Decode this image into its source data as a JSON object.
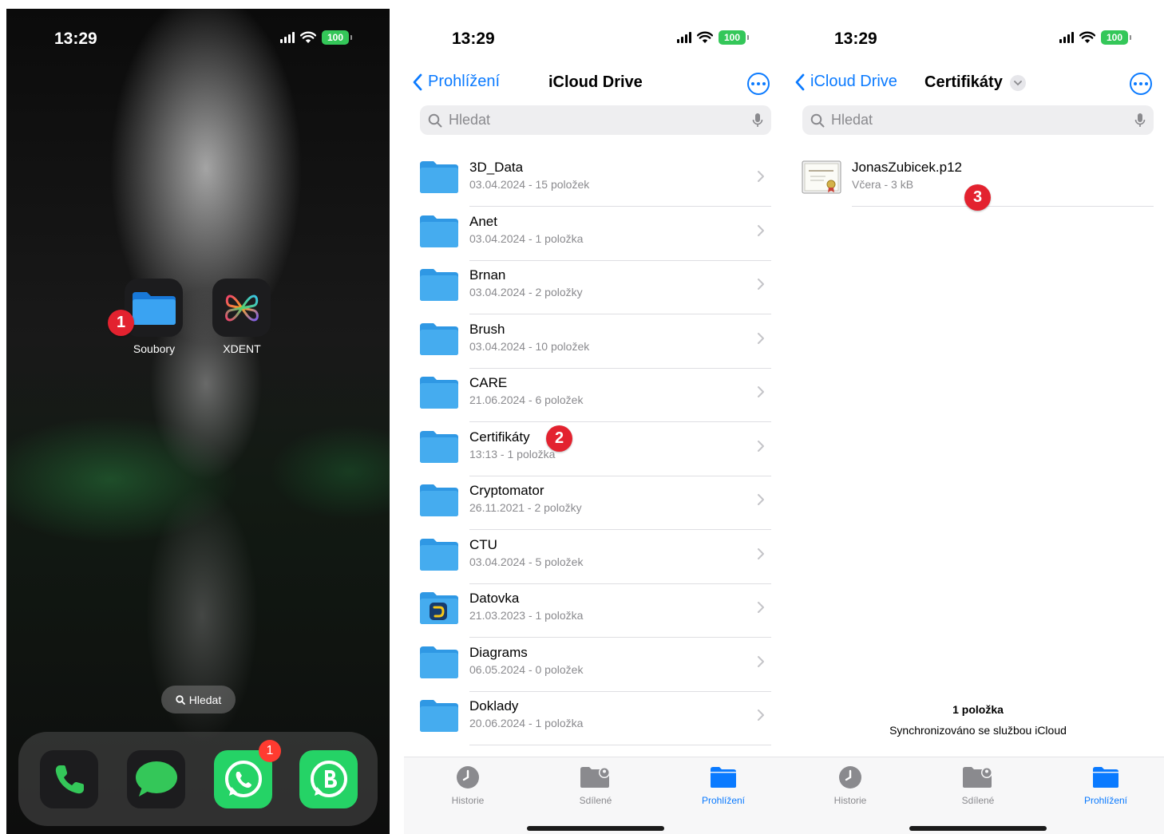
{
  "status": {
    "time": "13:29",
    "battery": "100"
  },
  "home": {
    "apps": [
      {
        "label": "Soubory"
      },
      {
        "label": "XDENT"
      }
    ],
    "search_label": "Hledat",
    "markers": [
      "1"
    ],
    "whatsapp_badge": "1",
    "dock_icons": [
      "phone-icon",
      "messages-icon",
      "whatsapp-icon",
      "whatsapp-business-icon"
    ]
  },
  "drive": {
    "back_label": "Prohlížení",
    "title": "iCloud Drive",
    "search_placeholder": "Hledat",
    "marker": "2",
    "folders": [
      {
        "name": "3D_Data",
        "meta": "03.04.2024 - 15 položek"
      },
      {
        "name": "Anet",
        "meta": "03.04.2024 - 1 položka"
      },
      {
        "name": "Brnan",
        "meta": "03.04.2024 - 2 položky"
      },
      {
        "name": "Brush",
        "meta": "03.04.2024 - 10 položek"
      },
      {
        "name": "CARE",
        "meta": "21.06.2024 - 6 položek"
      },
      {
        "name": "Certifikáty",
        "meta": "13:13 - 1 položka"
      },
      {
        "name": "Cryptomator",
        "meta": "26.11.2021 - 2 položky"
      },
      {
        "name": "CTU",
        "meta": "03.04.2024 - 5 položek"
      },
      {
        "name": "Datovka",
        "meta": "21.03.2023 - 1 položka"
      },
      {
        "name": "Diagrams",
        "meta": "06.05.2024 - 0 položek"
      },
      {
        "name": "Doklady",
        "meta": "20.06.2024 - 1 položka"
      }
    ]
  },
  "cert": {
    "back_label": "iCloud Drive",
    "title": "Certifikáty",
    "search_placeholder": "Hledat",
    "marker": "3",
    "file": {
      "name": "JonasZubicek.p12",
      "meta": "Včera - 3 kB"
    },
    "footer_count": "1 položka",
    "footer_sync": "Synchronizováno se službou iCloud"
  },
  "tabs": [
    {
      "label": "Historie",
      "icon": "clock-icon"
    },
    {
      "label": "Sdílené",
      "icon": "shared-folder-icon"
    },
    {
      "label": "Prohlížení",
      "icon": "folder-icon"
    }
  ],
  "colors": {
    "accent": "#0a7aff",
    "folder": "#3fa6ec",
    "marker": "#e3222f",
    "battery": "#34c759"
  }
}
